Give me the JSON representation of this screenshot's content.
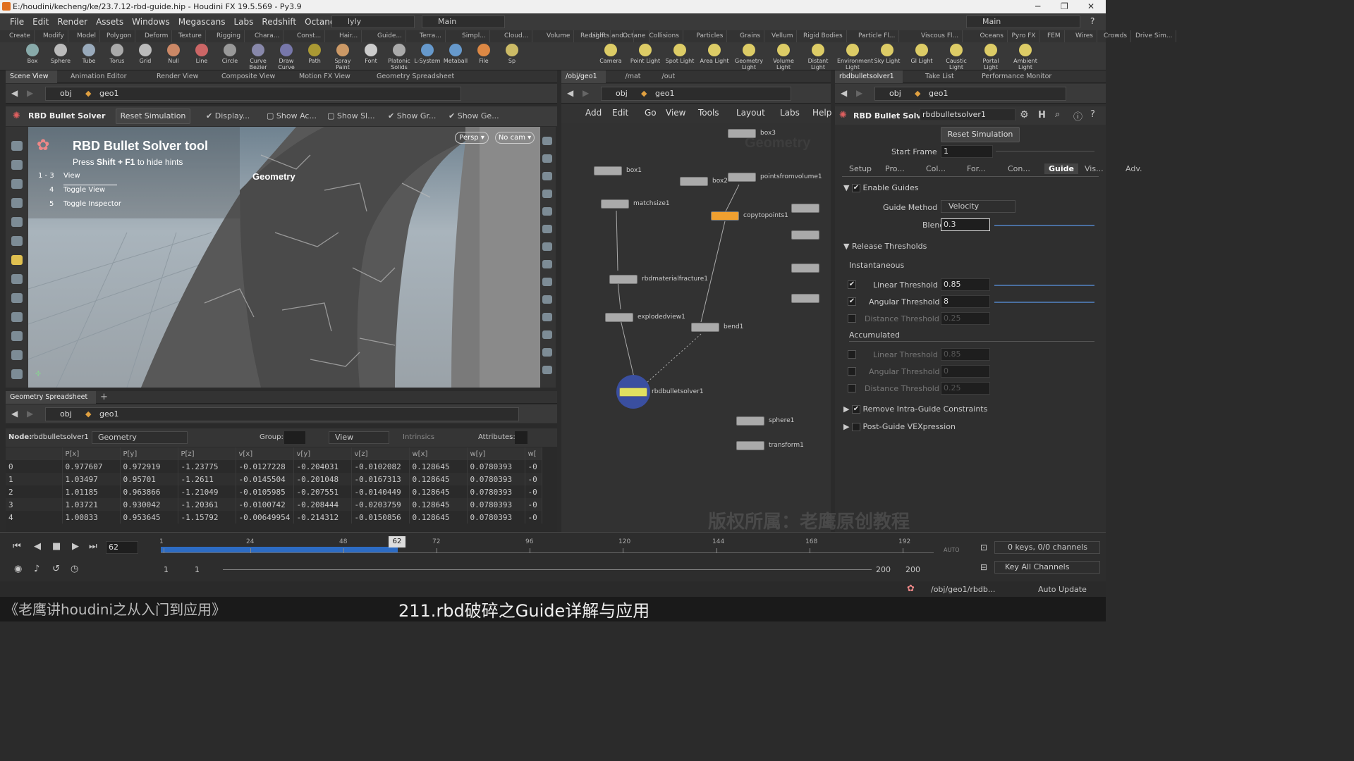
{
  "window": {
    "title": "E:/houdini/kecheng/ke/23.7.12-rbd-guide.hip - Houdini FX 19.5.569 - Py3.9"
  },
  "menu": [
    "File",
    "Edit",
    "Render",
    "Assets",
    "Windows",
    "Megascans",
    "Labs",
    "Redshift",
    "Octane",
    "Help"
  ],
  "desktop": {
    "layout": "lyly",
    "main1": "Main",
    "main2": "Main"
  },
  "shelf_tabs_left": [
    "Create",
    "Modify",
    "Model",
    "Polygon",
    "Deform",
    "Texture",
    "Rigging",
    "Chara...",
    "Const...",
    "Hair...",
    "Guide...",
    "Terra...",
    "Simpl...",
    "Cloud...",
    "Volume",
    "Redshift",
    "Octane"
  ],
  "shelf_tabs_right": [
    "Lights and...",
    "Collisions",
    "Particles",
    "Grains",
    "Vellum",
    "Rigid Bodies",
    "Particle Fl...",
    "Viscous Fl...",
    "Oceans",
    "Pyro FX",
    "FEM",
    "Wires",
    "Crowds",
    "Drive Sim..."
  ],
  "shelf_tools_left": [
    "Box",
    "Sphere",
    "Tube",
    "Torus",
    "Grid",
    "Null",
    "Line",
    "Circle",
    "Curve Bezier",
    "Draw Curve",
    "Path",
    "Spray Paint",
    "Font",
    "Platonic Solids",
    "L-System",
    "Metaball",
    "File",
    "Sp"
  ],
  "shelf_tools_right": [
    "Camera",
    "Point Light",
    "Spot Light",
    "Area Light",
    "Geometry Light",
    "Volume Light",
    "Distant Light",
    "Environment Light",
    "Sky Light",
    "GI Light",
    "Caustic Light",
    "Portal Light",
    "Ambient Light"
  ],
  "left_tabs": [
    "Scene View",
    "Animation Editor",
    "Render View",
    "Composite View",
    "Motion FX View",
    "Geometry Spreadsheet"
  ],
  "mid_tabs": [
    "/obj/geo1",
    "/mat",
    "/out"
  ],
  "right_tabs": [
    "rbdbulletsolver1",
    "Take List",
    "Performance Monitor"
  ],
  "path": {
    "root": "obj",
    "geo": "geo1"
  },
  "viewport": {
    "tool_name": "RBD Bullet Solver",
    "reset": "Reset Simulation",
    "toggles": [
      "Display...",
      "Show Ac...",
      "Show Sl...",
      "Show Gr...",
      "Show Ge..."
    ],
    "hint_title": "RBD Bullet Solver tool",
    "hint_sub_pre": "Press ",
    "hint_keys": "Shift + F1",
    "hint_sub_post": " to hide hints",
    "hints": [
      {
        "k": "1 - 3",
        "v": "View"
      },
      {
        "k": "4",
        "v": "Toggle View"
      },
      {
        "k": "5",
        "v": "Toggle Inspector"
      }
    ],
    "geo_label": "Geometry",
    "persp": "Persp",
    "nocam": "No cam"
  },
  "spreadsheet": {
    "tab": "Geometry Spreadsheet",
    "node_label": "Node:",
    "node": "rbdbulletsolver1",
    "mode": "Geometry",
    "group_label": "Group:",
    "view": "View",
    "intrinsics": "Intrinsics",
    "attributes": "Attributes:",
    "columns": [
      "",
      "P[x]",
      "P[y]",
      "P[z]",
      "v[x]",
      "v[y]",
      "v[z]",
      "w[x]",
      "w[y]",
      "w["
    ],
    "rows": [
      [
        "0",
        "0.977607",
        "0.972919",
        "-1.23775",
        "-0.0127228",
        "-0.204031",
        "-0.0102082",
        "0.128645",
        "0.0780393",
        "-0"
      ],
      [
        "1",
        "1.03497",
        "0.95701",
        "-1.2611",
        "-0.0145504",
        "-0.201048",
        "-0.0167313",
        "0.128645",
        "0.0780393",
        "-0"
      ],
      [
        "2",
        "1.01185",
        "0.963866",
        "-1.21049",
        "-0.0105985",
        "-0.207551",
        "-0.0140449",
        "0.128645",
        "0.0780393",
        "-0"
      ],
      [
        "3",
        "1.03721",
        "0.930042",
        "-1.20361",
        "-0.0100742",
        "-0.208444",
        "-0.0203759",
        "0.128645",
        "0.0780393",
        "-0"
      ],
      [
        "4",
        "1.00833",
        "0.953645",
        "-1.15792",
        "-0.00649954",
        "-0.214312",
        "-0.0150856",
        "0.128645",
        "0.0780393",
        "-0"
      ]
    ]
  },
  "network": {
    "menu": [
      "Add",
      "Edit",
      "Go",
      "View",
      "Tools",
      "Layout",
      "Labs",
      "Help"
    ],
    "watermark": "Geometry",
    "nodes": [
      "box3",
      "box1",
      "box2",
      "pointsfromvolume1",
      "matchsize1",
      "copytopoints1",
      "rbdmaterialfracture1",
      "explodedview1",
      "bend1",
      "rbdbulletsolver1",
      "sphere1",
      "transform1"
    ]
  },
  "params": {
    "node_type": "RBD Bullet Solver",
    "node_name": "rbdbulletsolver1",
    "reset": "Reset Simulation",
    "start_frame_label": "Start Frame",
    "start_frame": "1",
    "tabs": [
      "Setup",
      "Pro...",
      "Col...",
      "For...",
      "Con...",
      "Guide",
      "Vis...",
      "Adv."
    ],
    "enable_guides": "Enable Guides",
    "guide_method_label": "Guide Method",
    "guide_method": "Velocity",
    "blend_label": "Blend",
    "blend": "0.3",
    "release": "Release Thresholds",
    "instantaneous": "Instantaneous",
    "linear_label": "Linear Threshold",
    "linear": "0.85",
    "angular_label": "Angular Threshold",
    "angular": "8",
    "distance_label": "Distance Threshold",
    "distance": "0.25",
    "accumulated": "Accumulated",
    "acc_linear": "0.85",
    "acc_angular": "0",
    "acc_distance": "0.25",
    "remove": "Remove Intra-Guide Constraints",
    "post": "Post-Guide VEXpression"
  },
  "timeline": {
    "frame": "62",
    "marker": "62",
    "ticks": [
      "1",
      "24",
      "48",
      "72",
      "96",
      "120",
      "144",
      "168",
      "192"
    ],
    "start": "1",
    "start2": "1",
    "end": "200",
    "end2": "200",
    "keys": "0 keys, 0/0 channels",
    "keyall": "Key All Channels",
    "auto": "AUTO"
  },
  "status": {
    "path": "/obj/geo1/rbdb...",
    "update": "Auto Update"
  },
  "watermark_cn": "版权所属：老鹰原创教程",
  "caption": {
    "left": "《老鹰讲houdini之从入门到应用》",
    "center": "211.rbd破碎之Guide详解与应用"
  }
}
